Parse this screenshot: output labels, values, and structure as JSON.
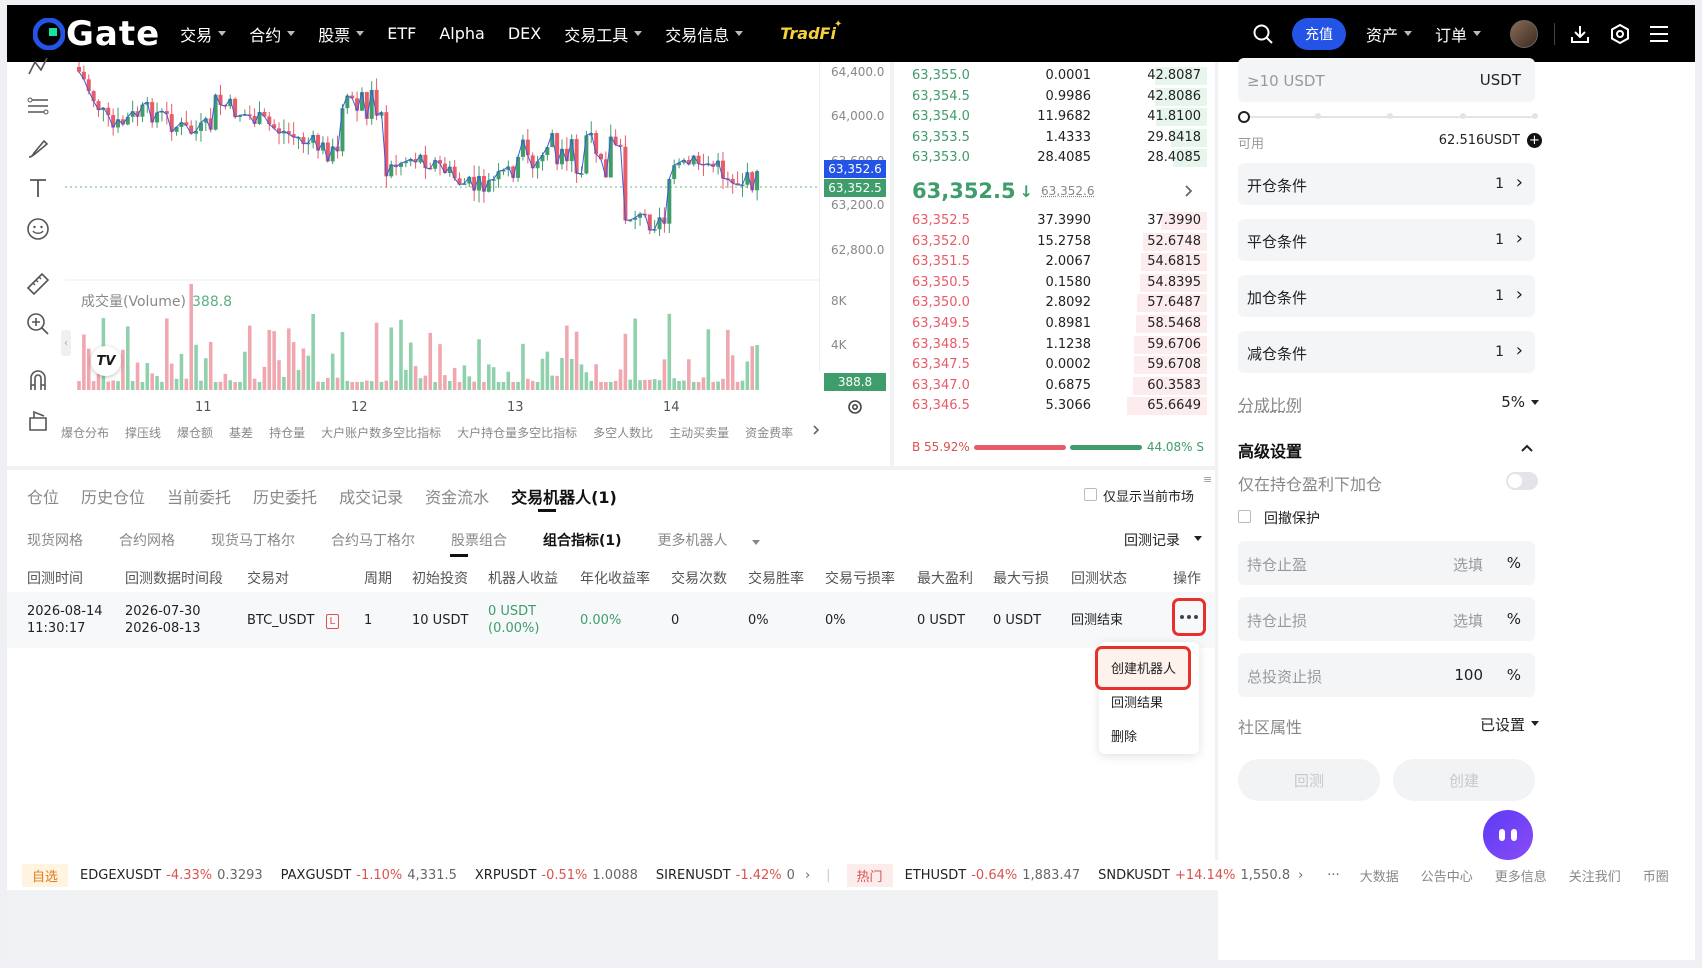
{
  "nav": {
    "logo": "Gate",
    "items": [
      {
        "label": "交易",
        "caret": true
      },
      {
        "label": "合约",
        "caret": true
      },
      {
        "label": "股票",
        "caret": true
      },
      {
        "label": "ETF",
        "caret": false
      },
      {
        "label": "Alpha",
        "caret": false
      },
      {
        "label": "DEX",
        "caret": false
      },
      {
        "label": "交易工具",
        "caret": true
      },
      {
        "label": "交易信息",
        "caret": true
      }
    ],
    "tradfi": "TradFi",
    "deposit": "充值",
    "assets": "资产",
    "orders": "订单"
  },
  "chart": {
    "price_ticks": [
      "64,400.0",
      "64,000.0",
      "63,600.0",
      "63,200.0",
      "62,800.0"
    ],
    "price_badge_red": "63,352.6",
    "price_badge_green": "63,352.5",
    "volume_label": "成交量(Volume)",
    "volume_value": "388.8",
    "volume_ticks": [
      "8K",
      "4K"
    ],
    "volume_badge": "388.8",
    "dates": [
      "11",
      "12",
      "13",
      "14"
    ],
    "indicators": [
      "爆仓分布",
      "撑压线",
      "爆仓额",
      "基差",
      "持仓量",
      "大户账户数多空比指标",
      "大户持仓量多空比指标",
      "多空人数比",
      "主动买卖量",
      "资金费率"
    ]
  },
  "orderbook": {
    "asks": [
      {
        "price": "63,355.0",
        "amount": "0.0001",
        "total": "42.8087",
        "depth": 0.65
      },
      {
        "price": "63,354.5",
        "amount": "0.9986",
        "total": "42.8086",
        "depth": 0.65
      },
      {
        "price": "63,354.0",
        "amount": "11.9682",
        "total": "41.8100",
        "depth": 0.64
      },
      {
        "price": "63,353.5",
        "amount": "1.4333",
        "total": "29.8418",
        "depth": 0.45
      },
      {
        "price": "63,353.0",
        "amount": "28.4085",
        "total": "28.4085",
        "depth": 0.43
      }
    ],
    "mid_price": "63,352.5",
    "mid_ref": "63,352.6",
    "bids": [
      {
        "price": "63,352.5",
        "amount": "37.3990",
        "total": "37.3990",
        "depth": 0.57
      },
      {
        "price": "63,352.0",
        "amount": "15.2758",
        "total": "52.6748",
        "depth": 0.8
      },
      {
        "price": "63,351.5",
        "amount": "2.0067",
        "total": "54.6815",
        "depth": 0.83
      },
      {
        "price": "63,350.5",
        "amount": "0.1580",
        "total": "54.8395",
        "depth": 0.84
      },
      {
        "price": "63,350.0",
        "amount": "2.8092",
        "total": "57.6487",
        "depth": 0.88
      },
      {
        "price": "63,349.5",
        "amount": "0.8981",
        "total": "58.5468",
        "depth": 0.89
      },
      {
        "price": "63,348.5",
        "amount": "1.1238",
        "total": "59.6706",
        "depth": 0.91
      },
      {
        "price": "63,347.5",
        "amount": "0.0002",
        "total": "59.6708",
        "depth": 0.91
      },
      {
        "price": "63,347.0",
        "amount": "0.6875",
        "total": "60.3583",
        "depth": 0.92
      },
      {
        "price": "63,346.5",
        "amount": "5.3066",
        "total": "65.6649",
        "depth": 1.0
      }
    ],
    "buy_ratio": "B 55.92%",
    "sell_ratio": "44.08% S",
    "buy_fraction": 0.5592
  },
  "right": {
    "invest_placeholder": "≥10 USDT",
    "invest_unit": "USDT",
    "available_label": "可用",
    "available_value": "62.516USDT",
    "conditions": [
      {
        "label": "开仓条件",
        "count": "1"
      },
      {
        "label": "平仓条件",
        "count": "1"
      },
      {
        "label": "加仓条件",
        "count": "1"
      },
      {
        "label": "减仓条件",
        "count": "1"
      }
    ],
    "split_label": "分成比例",
    "split_value": "5%",
    "advanced_label": "高级设置",
    "add_on_profit_label": "仅在持仓盈利下加仓",
    "drawdown_label": "回撤保护",
    "tp_label": "持仓止盈",
    "tp_placeholder": "选填",
    "sl_label": "持仓止损",
    "sl_placeholder": "选填",
    "total_sl_label": "总投资止损",
    "total_sl_value": "100",
    "percent": "%",
    "community_label": "社区属性",
    "community_value": "已设置",
    "backtest_button": "回测",
    "create_button": "创建"
  },
  "bottom": {
    "tabs": [
      "仓位",
      "历史仓位",
      "当前委托",
      "历史委托",
      "成交记录",
      "资金流水",
      "交易机器人(1)"
    ],
    "show_current": "仅显示当前市场",
    "subtabs": [
      "现货网格",
      "合约网格",
      "现货马丁格尔",
      "合约马丁格尔",
      "股票组合",
      "组合指标(1)",
      "更多机器人"
    ],
    "backtest_record": "回测记录",
    "headers": [
      "回测时间",
      "回测数据时间段",
      "交易对",
      "周期",
      "初始投资",
      "机器人收益",
      "年化收益率",
      "交易次数",
      "交易胜率",
      "交易亏损率",
      "最大盈利",
      "最大亏损",
      "回测状态",
      "操作"
    ],
    "row": {
      "time_date": "2026-08-14",
      "time_clock": "11:30:17",
      "period_start": "2026-07-30",
      "period_end": "2026-08-13",
      "pair": "BTC_USDT",
      "pair_badge": "L",
      "cycle": "1",
      "invest": "10 USDT",
      "profit": "0 USDT",
      "profit_pct": "(0.00%)",
      "annual": "0.00%",
      "trades": "0",
      "win_rate": "0%",
      "loss_rate": "0%",
      "max_profit": "0 USDT",
      "max_loss": "0 USDT",
      "status": "回测结束"
    },
    "menu": [
      "创建机器人",
      "回测结果",
      "删除"
    ]
  },
  "ticker": {
    "fav_label": "自选",
    "fav": [
      {
        "symbol": "EDGEXUSDT",
        "change": "-4.33%",
        "price": "0.3293",
        "dir": "up"
      },
      {
        "symbol": "PAXGUSDT",
        "change": "-1.10%",
        "price": "4,331.5",
        "dir": "up"
      },
      {
        "symbol": "XRPUSDT",
        "change": "-0.51%",
        "price": "1.0088",
        "dir": "up"
      },
      {
        "symbol": "SIRENUSDT",
        "change": "-1.42%",
        "price": "0",
        "dir": "up"
      }
    ],
    "hot_label": "热门",
    "hot": [
      {
        "symbol": "ETHUSDT",
        "change": "-0.64%",
        "price": "1,883.47",
        "dir": "up"
      },
      {
        "symbol": "SNDKUSDT",
        "change": "+14.14%",
        "price": "1,550.8",
        "dir": "up"
      }
    ],
    "links": [
      "大数据",
      "公告中心",
      "更多信息",
      "关注我们",
      "币圈"
    ]
  }
}
